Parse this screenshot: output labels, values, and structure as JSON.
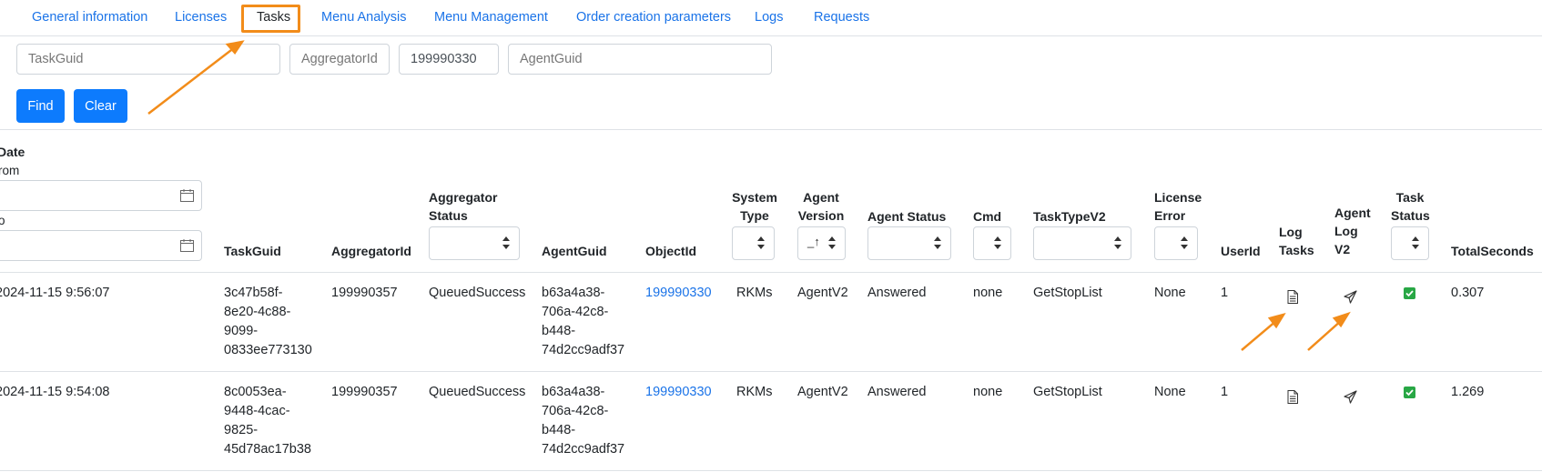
{
  "tabs": [
    {
      "label": "General information",
      "active": false
    },
    {
      "label": "Licenses",
      "active": false
    },
    {
      "label": "Tasks",
      "active": true
    },
    {
      "label": "Menu Analysis",
      "active": false
    },
    {
      "label": "Menu Management",
      "active": false
    },
    {
      "label": "Order creation parameters",
      "active": false
    },
    {
      "label": "Logs",
      "active": false
    },
    {
      "label": "Requests",
      "active": false
    }
  ],
  "filters": {
    "task_guid": {
      "placeholder": "TaskGuid",
      "value": ""
    },
    "aggregator_id": {
      "placeholder": "AggregatorId",
      "value": ""
    },
    "object_id": {
      "placeholder": "",
      "value": "199990330"
    },
    "agent_guid": {
      "placeholder": "AgentGuid",
      "value": ""
    }
  },
  "buttons": {
    "find": "Find",
    "clear": "Clear"
  },
  "date_filter": {
    "label": "Date",
    "from_label": "rom",
    "to_label": "o",
    "truncated_label": "Date"
  },
  "columns": {
    "date": "Date",
    "task_guid": "TaskGuid",
    "aggregator_id": "AggregatorId",
    "aggregator_status": "Aggregator Status",
    "agent_guid": "AgentGuid",
    "object_id": "ObjectId",
    "system_type": "System Type",
    "agent_version": "Agent Version",
    "agent_status": "Agent Status",
    "cmd": "Cmd",
    "task_type_v2": "TaskTypeV2",
    "license_error": "License Error",
    "user_id": "UserId",
    "log_tasks": "Log Tasks",
    "agent_log_v2": "Agent Log V2",
    "task_status": "Task Status",
    "total_seconds": "TotalSeconds"
  },
  "agent_version_select_value": "_↑",
  "rows": [
    {
      "date": "2024-11-15 9:56:07",
      "task_guid": "3c47b58f-8e20-4c88-9099-0833ee773130",
      "aggregator_id": "199990357",
      "aggregator_status": "QueuedSuccess",
      "agent_guid": "b63a4a38-706a-42c8-b448-74d2cc9adf37",
      "object_id": "199990330",
      "system_type": "RKMs",
      "agent_version": "AgentV2",
      "agent_status": "Answered",
      "cmd": "none",
      "task_type_v2": "GetStopList",
      "license_error": "None",
      "user_id": "1",
      "total_seconds": "0.307"
    },
    {
      "date": "2024-11-15 9:54:08",
      "task_guid": "8c0053ea-9448-4cac-9825-45d78ac17b38",
      "aggregator_id": "199990357",
      "aggregator_status": "QueuedSuccess",
      "agent_guid": "b63a4a38-706a-42c8-b448-74d2cc9adf37",
      "object_id": "199990330",
      "system_type": "RKMs",
      "agent_version": "AgentV2",
      "agent_status": "Answered",
      "cmd": "none",
      "task_type_v2": "GetStopList",
      "license_error": "None",
      "user_id": "1",
      "total_seconds": "1.269"
    }
  ],
  "row_lines": {
    "r0": {
      "date": "2024-11-15 9:56:07",
      "tg": [
        "3c47b58f-",
        "8e20-4c88-",
        "9099-",
        "0833ee773130"
      ],
      "ag": [
        "b63a4a38-",
        "706a-42c8-",
        "b448-",
        "74d2cc9adf37"
      ]
    },
    "r1": {
      "date": "2024-11-15 9:54:08",
      "tg": [
        "8c0053ea-",
        "9448-4cac-",
        "9825-",
        "45d78ac17b38"
      ],
      "ag": [
        "b63a4a38-",
        "706a-42c8-",
        "b448-",
        "74d2cc9adf37"
      ]
    }
  },
  "header_lines": {
    "aggregator_status": [
      "Aggregator",
      "Status"
    ],
    "system_type": [
      "System",
      "Type"
    ],
    "agent_version": [
      "Agent",
      "Version"
    ],
    "license_error": [
      "License",
      "Error"
    ],
    "log_tasks": [
      "Log",
      "Tasks"
    ],
    "agent_log_v2": [
      "Agent",
      "Log",
      "V2"
    ],
    "task_status": [
      "Task",
      "Status"
    ]
  },
  "colors": {
    "accent": "#0d7bfd",
    "link": "#1a73e8",
    "highlight": "#f28c1a",
    "success": "#28a745"
  },
  "icons": {
    "log_tasks": "document-icon",
    "agent_log": "paper-plane-icon",
    "task_status": "checkbox-checked-icon",
    "calendar": "calendar-icon"
  }
}
